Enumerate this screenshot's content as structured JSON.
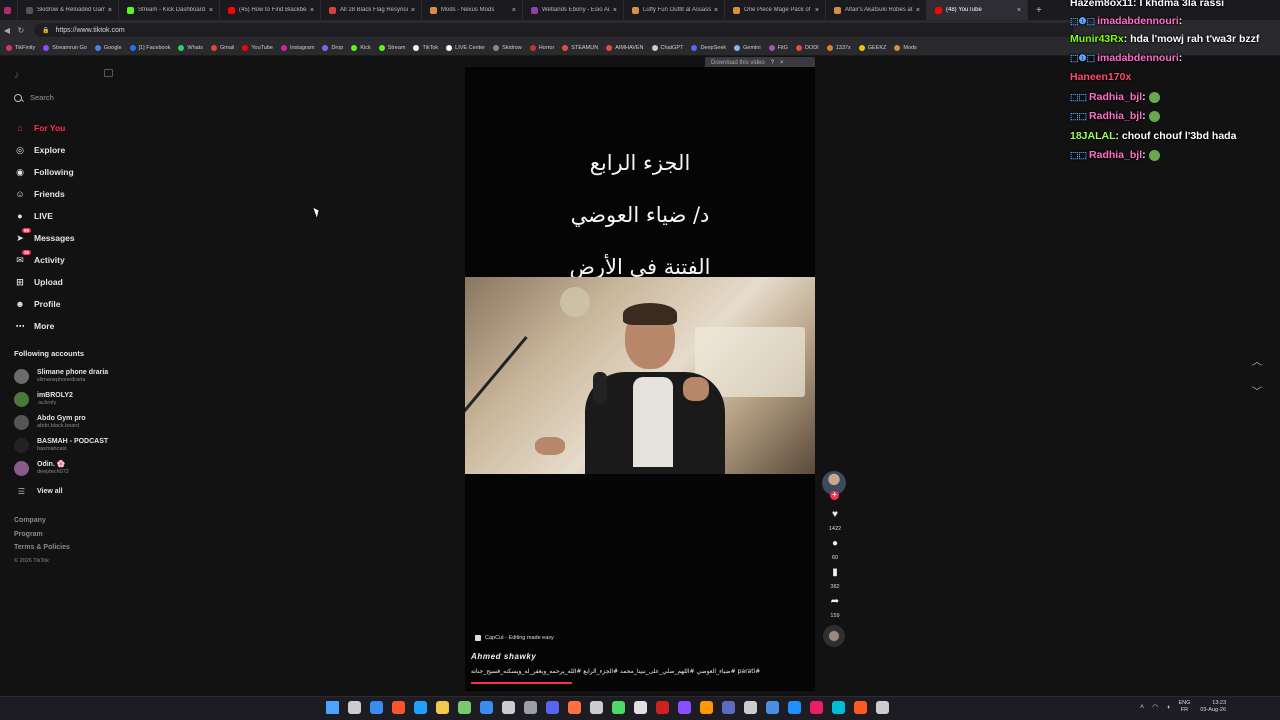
{
  "browser": {
    "tabs": [
      {
        "title": "",
        "color": "#b02a6c",
        "active": false
      },
      {
        "title": "Skidrow & Reloaded Games",
        "color": "#555555",
        "active": false
      },
      {
        "title": "Stream - Kick Dashboard",
        "color": "#53fc18",
        "active": false
      },
      {
        "title": "(45) How to Find Blackbeard",
        "color": "#ff0000",
        "active": false
      },
      {
        "title": "All 28 Black Flag Resynced",
        "color": "#d94040",
        "active": false
      },
      {
        "title": "Mods - Nexus Mods",
        "color": "#d98f40",
        "active": false
      },
      {
        "title": "Wetlands Ebony - Esio Audit",
        "color": "#8844aa",
        "active": false
      },
      {
        "title": "Luffy Fun Outfit at Assassin",
        "color": "#d98f40",
        "active": false
      },
      {
        "title": "One Piece Mage Pack of Fun",
        "color": "#d98f40",
        "active": false
      },
      {
        "title": "Altair's Akatsuki Robes at Assa",
        "color": "#d98f40",
        "active": false
      },
      {
        "title": "(48) YouTube",
        "color": "#ff0000",
        "active": true
      }
    ],
    "url": "https://www.tiktok.com",
    "bookmarks": [
      {
        "label": "TikFinity",
        "color": "#e0306a"
      },
      {
        "label": "Streamrun Go",
        "color": "#8a4fff"
      },
      {
        "label": "Google",
        "color": "#4285f4"
      },
      {
        "label": "[1] Facebook",
        "color": "#1877f2"
      },
      {
        "label": "Whats",
        "color": "#25d366"
      },
      {
        "label": "Gmail",
        "color": "#ea4335"
      },
      {
        "label": "YouTube",
        "color": "#ff0000"
      },
      {
        "label": "Instagram",
        "color": "#d6249f"
      },
      {
        "label": "Drop",
        "color": "#7b68ee"
      },
      {
        "label": "Kick",
        "color": "#53fc18"
      },
      {
        "label": "Stream",
        "color": "#53fc18"
      },
      {
        "label": "TikTok",
        "color": "#ffffff"
      },
      {
        "label": "LIVE Center",
        "color": "#ffffff"
      },
      {
        "label": "Skidrow",
        "color": "#888888"
      },
      {
        "label": "Horror",
        "color": "#c0392b"
      },
      {
        "label": "STEAMUN",
        "color": "#e74c3c"
      },
      {
        "label": "AIMHAVEN",
        "color": "#e74c3c"
      },
      {
        "label": "ChatGPT",
        "color": "#cccccc"
      },
      {
        "label": "DeepSeek",
        "color": "#4d6bfe"
      },
      {
        "label": "Gemini",
        "color": "#8ab4f8"
      },
      {
        "label": "FitG",
        "color": "#9b59b6"
      },
      {
        "label": "DODI",
        "color": "#e74c3c"
      },
      {
        "label": "1337x",
        "color": "#e67e22"
      },
      {
        "label": "GEEKZ",
        "color": "#f1c40f"
      },
      {
        "label": "Mods",
        "color": "#d98f40"
      }
    ]
  },
  "sidebar": {
    "search_placeholder": "Search",
    "nav": [
      {
        "label": "For You",
        "icon": "home-icon",
        "glyph": "⌂",
        "active": true,
        "badge": ""
      },
      {
        "label": "Explore",
        "icon": "compass-icon",
        "glyph": "◎",
        "active": false,
        "badge": ""
      },
      {
        "label": "Following",
        "icon": "following-icon",
        "glyph": "◉",
        "active": false,
        "badge": ""
      },
      {
        "label": "Friends",
        "icon": "friends-icon",
        "glyph": "☺",
        "active": false,
        "badge": ""
      },
      {
        "label": "LIVE",
        "icon": "live-icon",
        "glyph": "●",
        "active": false,
        "badge": ""
      },
      {
        "label": "Messages",
        "icon": "messages-icon",
        "glyph": "➤",
        "active": false,
        "badge": "99"
      },
      {
        "label": "Activity",
        "icon": "activity-icon",
        "glyph": "✉",
        "active": false,
        "badge": "35"
      },
      {
        "label": "Upload",
        "icon": "upload-icon",
        "glyph": "⊞",
        "active": false,
        "badge": ""
      },
      {
        "label": "Profile",
        "icon": "profile-icon",
        "glyph": "☻",
        "active": false,
        "badge": ""
      },
      {
        "label": "More",
        "icon": "more-icon",
        "glyph": "⋯",
        "active": false,
        "badge": ""
      }
    ],
    "following_title": "Following accounts",
    "following": [
      {
        "name": "Slimane phone draria",
        "handle": "slimanephonedraria",
        "color": "#6b6b6b"
      },
      {
        "name": "imBROLY2",
        "handle": ".ia.broly",
        "color": "#4a7a3a"
      },
      {
        "name": "Abdo Gym pro",
        "handle": "abdo.black.beard",
        "color": "#555555"
      },
      {
        "name": "BASMAH - PODCAST",
        "handle": "basmahcast",
        "color": "#222222"
      },
      {
        "name": "Odin. 🌸",
        "handle": "deeptech072",
        "color": "#8a5a8a"
      }
    ],
    "view_all": "View all",
    "footer": [
      "Company",
      "Program",
      "Terms & Policies"
    ],
    "copyright": "© 2026 TikTok"
  },
  "video": {
    "download_label": "Download this video",
    "lines": [
      "الجزء الرابع",
      "د/ ضياء العوضي",
      "الفتنة في الأرض"
    ],
    "capcut": "CapCut - Editing made easy",
    "author": "Ahmed shawky",
    "caption": "#parati #ضياء_العوضي #اللهم_صلي_على_نبينا_محمد #الجزء_الرابع #الله_يرحمه_ويغفر_له_ويسكنه_فسيح_جناته",
    "progress": 0.3
  },
  "actions": {
    "likes": "1422",
    "comments": "60",
    "saves": "382",
    "shares": "159"
  },
  "chat": [
    {
      "user": "Hazem8ox11",
      "msg": ": I khdma 3la rassi",
      "color": "#ffffff",
      "badges": ""
    },
    {
      "user": "imadabdennouri",
      "msg": ":",
      "color": "#ff6ec7",
      "badges": "⬚❶⬚"
    },
    {
      "user": "Munir43Rx",
      "msg": ": hda l'mowj rah t'wa3r bzzf",
      "color": "#7fff00",
      "badges": ""
    },
    {
      "user": "imadabdennouri",
      "msg": ":",
      "color": "#ff6ec7",
      "badges": "⬚❶⬚"
    },
    {
      "user": "Haneen170x",
      "msg": "",
      "color": "#ff4d6d",
      "badges": ""
    },
    {
      "user": "Radhia_bjl",
      "msg": ":",
      "color": "#ff6ec7",
      "badges": "⬚⬚"
    },
    {
      "user": "Radhia_bjl",
      "msg": ":",
      "color": "#ff6ec7",
      "badges": "⬚⬚"
    },
    {
      "user": "18JALAL",
      "msg": ": chouf chouf l'3bd hada",
      "color": "#9cff57",
      "badges": ""
    },
    {
      "user": "Radhia_bjl",
      "msg": ":",
      "color": "#ff6ec7",
      "badges": "⬚⬚"
    }
  ],
  "taskbar": {
    "lang_top": "ENG",
    "lang_bottom": "FR",
    "time": "13:23",
    "date": "03-Aug-26",
    "icons": [
      "#4aa3ff",
      "#cccccc",
      "#3c8bf0",
      "#fb542b",
      "#1fa2ff",
      "#f2c94c",
      "#7bc96f",
      "#3c8bf0",
      "#cccccc",
      "#9aa0a6",
      "#5865f2",
      "#ff7043",
      "#cccccc",
      "#4cd964",
      "#e0e0e0",
      "#cc2222",
      "#8a4fff",
      "#ff9800",
      "#5c6bc0",
      "#cccccc",
      "#4a90e2",
      "#1e90ff",
      "#e91e63",
      "#00bcd4",
      "#ff5722",
      "#cccccc"
    ]
  },
  "colors": {
    "accent": "#fe2c55"
  }
}
